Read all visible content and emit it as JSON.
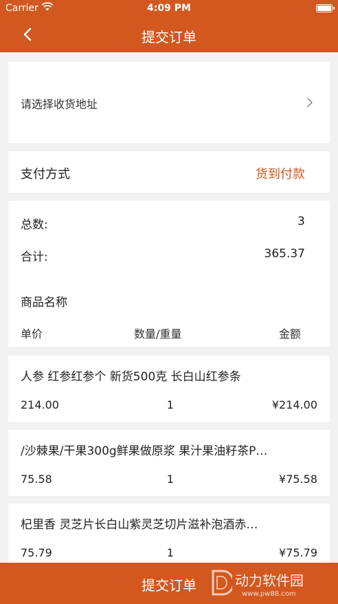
{
  "status_bar": {
    "carrier": "Carrier",
    "time": "4:09 PM"
  },
  "nav": {
    "title": "提交订单"
  },
  "address": {
    "label": "请选择收货地址"
  },
  "payment": {
    "label": "支付方式",
    "value": "货到付款"
  },
  "summary": {
    "total_count_label": "总数:",
    "total_count_value": "3",
    "total_label": "合计:",
    "total_value": "365.37",
    "product_name_header": "商品名称",
    "col_price": "单价",
    "col_qty": "数量/重量",
    "col_amount": "金额"
  },
  "items": [
    {
      "name": "人参 红参红参个 新货500克 长白山红参条",
      "price": "214.00",
      "qty": "1",
      "amount": "¥214.00"
    },
    {
      "name": "/沙棘果/干果300g鲜果做原浆 果汁果油籽茶P…",
      "price": "75.58",
      "qty": "1",
      "amount": "¥75.58"
    },
    {
      "name": "杞里香 灵芝片长白山紫灵芝切片滋补泡酒赤…",
      "price": "75.79",
      "qty": "1",
      "amount": "¥75.79"
    }
  ],
  "submit": {
    "label": "提交订单"
  },
  "watermark": {
    "text": "动力软件园",
    "url": "www.pw88.com"
  },
  "colors": {
    "accent": "#d2581f",
    "background": "#f2f2f2"
  },
  "icons": [
    "back-arrow-icon",
    "chevron-right-icon",
    "wifi-icon",
    "battery-icon"
  ]
}
